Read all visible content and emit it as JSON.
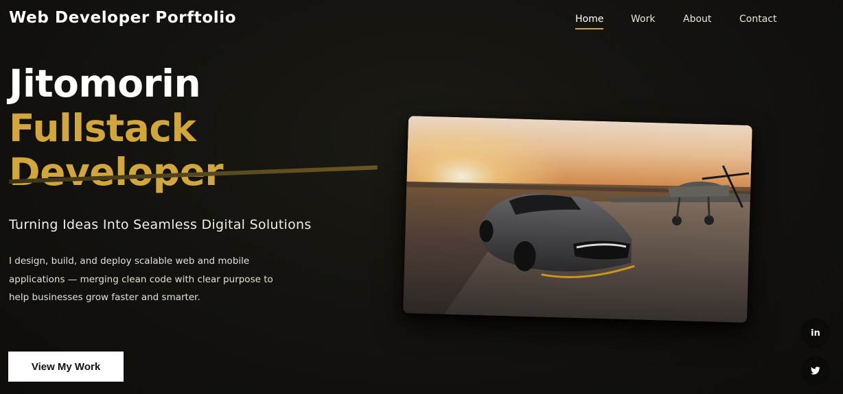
{
  "header": {
    "brand": "Web Developer Porftolio",
    "nav": [
      {
        "label": "Home",
        "active": true
      },
      {
        "label": "Work",
        "active": false
      },
      {
        "label": "About",
        "active": false
      },
      {
        "label": "Contact",
        "active": false
      }
    ]
  },
  "hero": {
    "name": "Jitomorin",
    "role": "Fullstack Developer",
    "tagline": "Turning Ideas Into Seamless Digital Solutions",
    "intro": "I design, build, and deploy scalable web and mobile applications — merging clean code with clear purpose to help businesses grow faster and smarter.",
    "cta_label": "View My Work",
    "image_subject": "sports car and vintage fighter plane at sunset"
  },
  "social": [
    {
      "icon": "linkedin-icon",
      "glyph": "in"
    },
    {
      "icon": "twitter-icon",
      "glyph": "twitter"
    }
  ],
  "colors": {
    "background": "#12110d",
    "accent": "#d1a63a",
    "text": "#ffffff",
    "button_bg": "#ffffff",
    "button_text": "#111111"
  }
}
